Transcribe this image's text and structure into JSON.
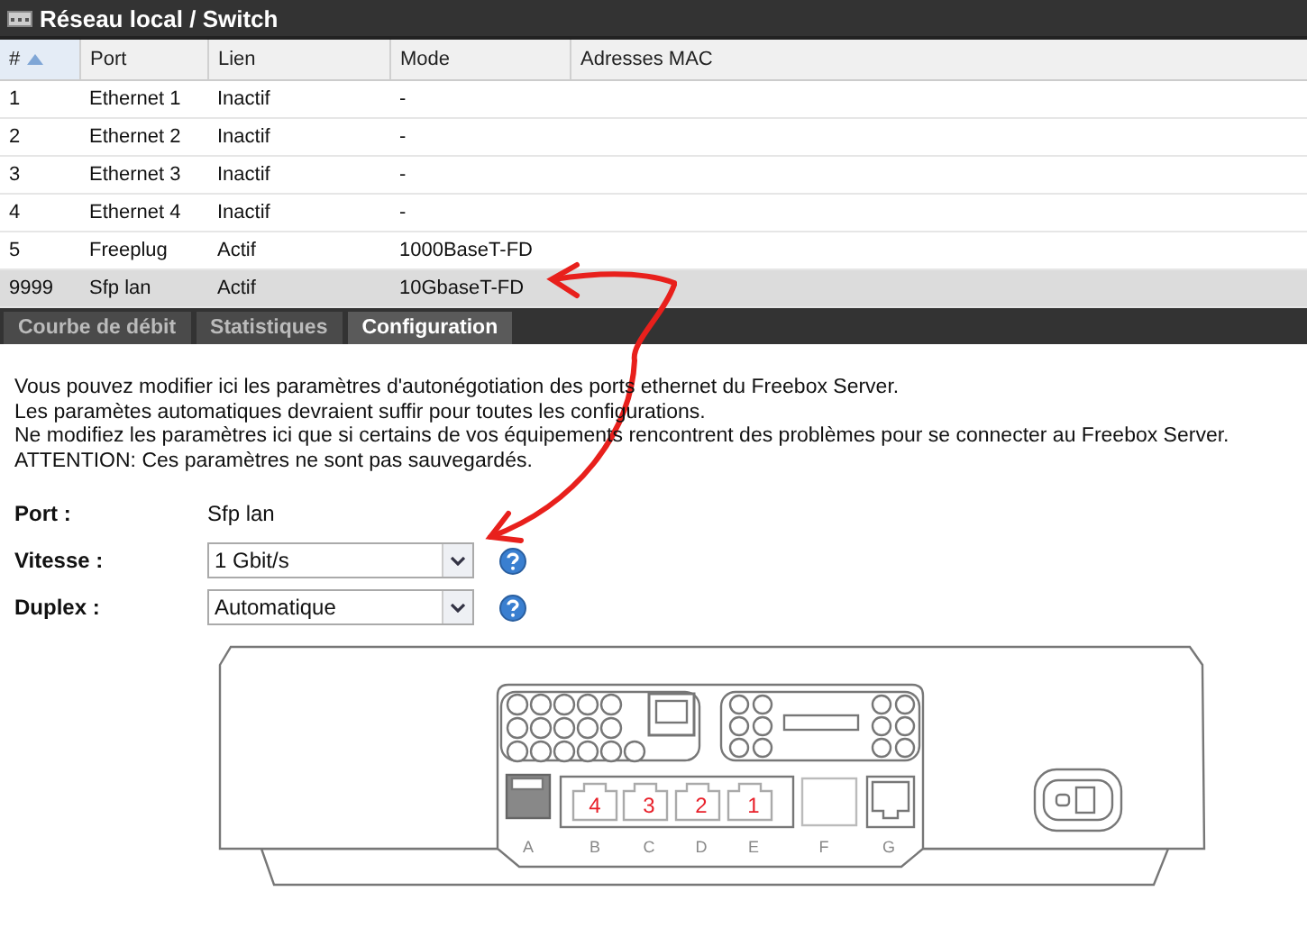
{
  "window": {
    "title": "Réseau local / Switch"
  },
  "table": {
    "columns": [
      {
        "label": "#",
        "sorted": true
      },
      {
        "label": "Port",
        "sorted": false
      },
      {
        "label": "Lien",
        "sorted": false
      },
      {
        "label": "Mode",
        "sorted": false
      },
      {
        "label": "Adresses MAC",
        "sorted": false
      }
    ],
    "rows": [
      {
        "cells": [
          "1",
          "Ethernet 1",
          "Inactif",
          "-",
          ""
        ],
        "selected": false
      },
      {
        "cells": [
          "2",
          "Ethernet 2",
          "Inactif",
          "-",
          ""
        ],
        "selected": false
      },
      {
        "cells": [
          "3",
          "Ethernet 3",
          "Inactif",
          "-",
          ""
        ],
        "selected": false
      },
      {
        "cells": [
          "4",
          "Ethernet 4",
          "Inactif",
          "-",
          ""
        ],
        "selected": false
      },
      {
        "cells": [
          "5",
          "Freeplug",
          "Actif",
          "1000BaseT-FD",
          ""
        ],
        "selected": false
      },
      {
        "cells": [
          "9999",
          "Sfp lan",
          "Actif",
          "10GbaseT-FD",
          ""
        ],
        "selected": true
      }
    ]
  },
  "tabs": [
    {
      "label": "Courbe de débit",
      "selected": false
    },
    {
      "label": "Statistiques",
      "selected": false
    },
    {
      "label": "Configuration",
      "selected": true
    }
  ],
  "intro": [
    "Vous pouvez modifier ici les paramètres d'autonégotiation des ports ethernet du Freebox Server.",
    "Les paramètes automatiques devraient suffir pour toutes les configurations.",
    "Ne modifiez les paramètres ici que si certains de vos équipements rencontrent des problèmes pour se connecter au Freebox Server.",
    "ATTENTION: Ces paramètres ne sont pas sauvegardés."
  ],
  "form": [
    {
      "kind": "text",
      "label": "Port :",
      "value": "Sfp lan"
    },
    {
      "kind": "select",
      "label": "Vitesse :",
      "value": "1 Gbit/s"
    },
    {
      "kind": "select",
      "label": "Duplex :",
      "value": "Automatique"
    }
  ],
  "device": {
    "ports": [
      {
        "letter": "A"
      },
      {
        "letter": "B",
        "number": "4"
      },
      {
        "letter": "C",
        "number": "3"
      },
      {
        "letter": "D",
        "number": "2"
      },
      {
        "letter": "E",
        "number": "1"
      },
      {
        "letter": "F"
      },
      {
        "letter": "G"
      }
    ]
  }
}
